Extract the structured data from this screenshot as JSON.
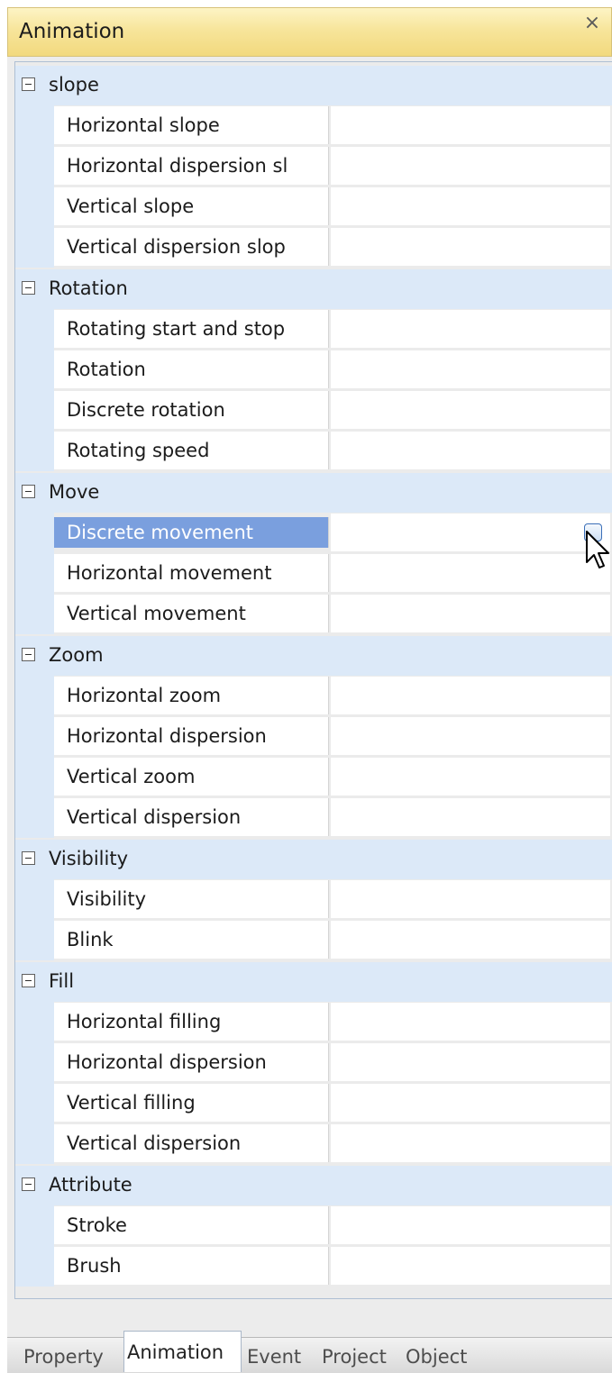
{
  "panel": {
    "title": "Animation",
    "close_icon": "close-icon"
  },
  "property_grid": {
    "categories": [
      {
        "label": "slope",
        "items": [
          "Horizontal slope",
          "Horizontal dispersion sl",
          "Vertical slope",
          "Vertical dispersion slop"
        ]
      },
      {
        "label": "Rotation",
        "items": [
          "Rotating start and stop",
          "Rotation",
          "Discrete rotation",
          "Rotating speed"
        ]
      },
      {
        "label": "Move",
        "items": [
          "Discrete movement",
          "Horizontal movement",
          "Vertical movement"
        ]
      },
      {
        "label": "Zoom",
        "items": [
          "Horizontal zoom",
          "Horizontal dispersion",
          "Vertical zoom",
          "Vertical dispersion"
        ]
      },
      {
        "label": "Visibility",
        "items": [
          "Visibility",
          "Blink"
        ]
      },
      {
        "label": "Fill",
        "items": [
          "Horizontal filling",
          "Horizontal dispersion",
          "Vertical filling",
          "Vertical dispersion"
        ]
      },
      {
        "label": "Attribute",
        "items": [
          "Stroke",
          "Brush"
        ]
      }
    ],
    "selected_item": "Discrete movement",
    "selection_color": "#7a9fde",
    "category_background": "#dce9f8"
  },
  "tabs": [
    {
      "label": "Property",
      "active": false
    },
    {
      "label": "Animation",
      "active": true
    },
    {
      "label": "Event",
      "active": false
    },
    {
      "label": "Project",
      "active": false
    },
    {
      "label": "Object",
      "active": false
    }
  ]
}
